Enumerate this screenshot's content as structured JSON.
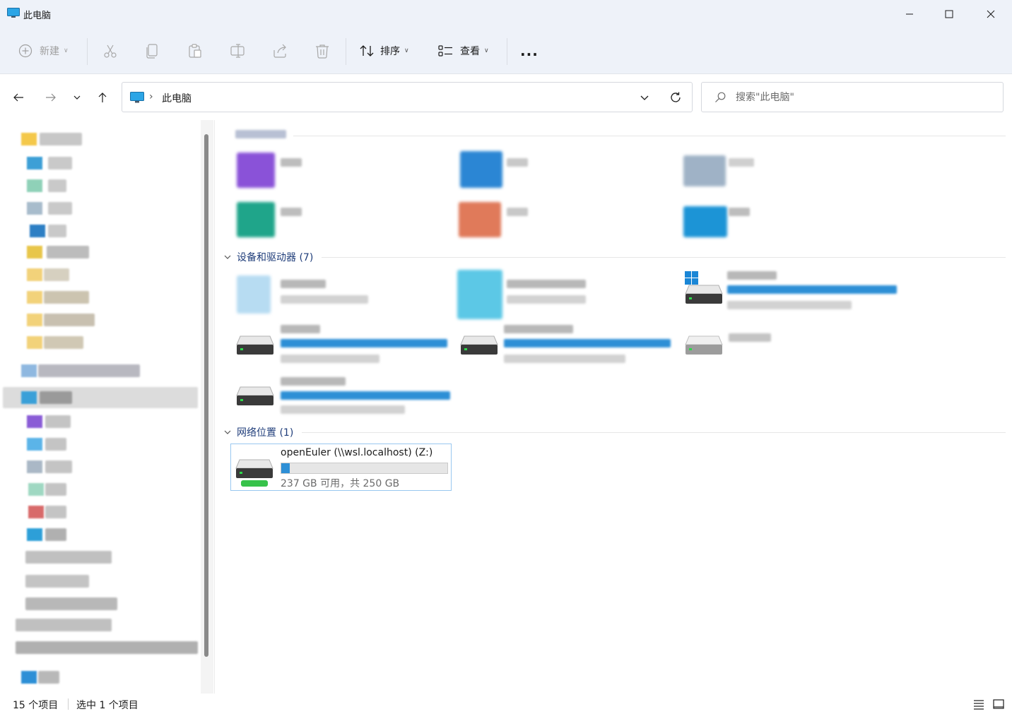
{
  "window": {
    "title": "此电脑",
    "controls": [
      "minimize",
      "maximize",
      "close"
    ]
  },
  "toolbar": {
    "new_label": "新建",
    "sort_label": "排序",
    "view_label": "查看",
    "more_label": "...",
    "icons": [
      "cut-icon",
      "copy-icon",
      "paste-icon",
      "rename-icon",
      "share-icon",
      "delete-icon"
    ]
  },
  "address": {
    "crumb": "此电脑",
    "separator": "›"
  },
  "search": {
    "placeholder": "搜索\"此电脑\""
  },
  "sections": {
    "devices_header": "设备和驱动器 (7)",
    "network_header": "网络位置 (1)"
  },
  "network_drive": {
    "name": "openEuler (\\\\wsl.localhost) (Z:)",
    "space_text": "237 GB 可用，共 250 GB",
    "used_fraction": 0.052
  },
  "status": {
    "item_count": "15 个项目",
    "selection": "选中 1 个项目"
  },
  "colors": {
    "accent": "#2d8fd6",
    "section_header": "#1f3d7a",
    "chrome_bg": "#eef2f9",
    "selection_border": "#99c8f0"
  }
}
